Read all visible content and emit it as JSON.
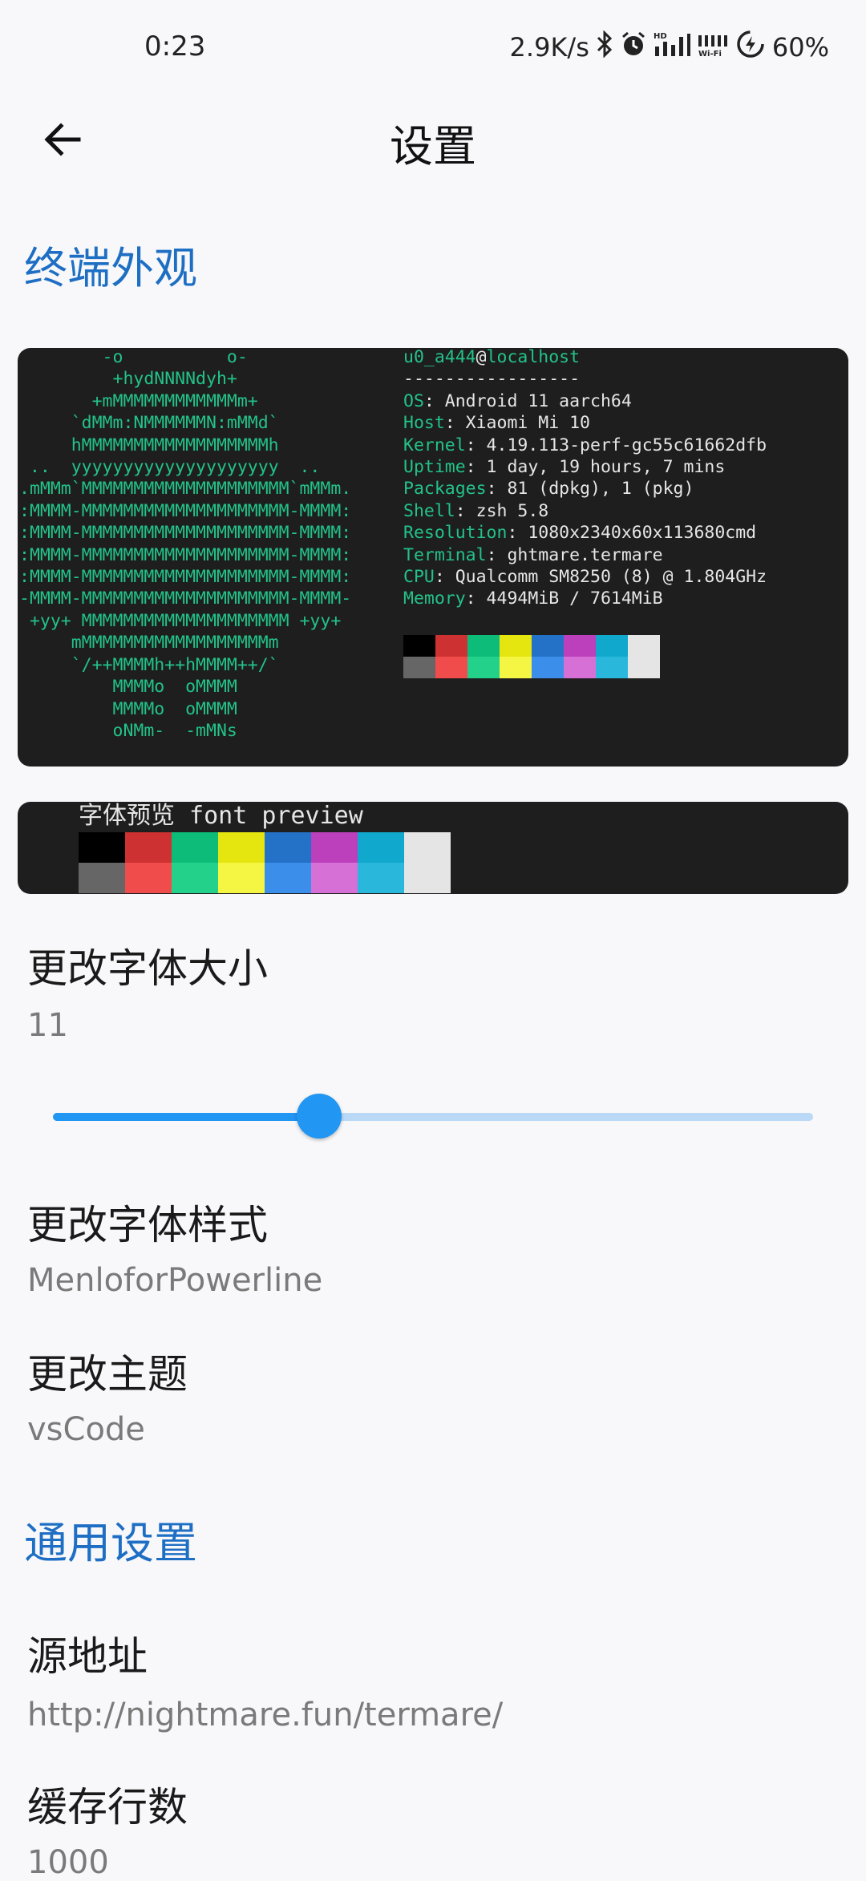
{
  "status_bar": {
    "time": "0:23",
    "net_speed": "2.9K/s",
    "battery": "60%"
  },
  "app_bar": {
    "title": "设置"
  },
  "sections": {
    "appearance": "终端外观",
    "general": "通用设置"
  },
  "neofetch": {
    "user": "u0_a444",
    "at": "@",
    "host": "localhost",
    "separator": "-----------------",
    "info": [
      {
        "key": "OS",
        "value": ": Android 11 aarch64"
      },
      {
        "key": "Host",
        "value": ": Xiaomi Mi 10"
      },
      {
        "key": "Kernel",
        "value": ": 4.19.113-perf-gc55c61662dfb"
      },
      {
        "key": "Uptime",
        "value": ": 1 day, 19 hours, 7 mins"
      },
      {
        "key": "Packages",
        "value": ": 81 (dpkg), 1 (pkg)"
      },
      {
        "key": "Shell",
        "value": ": zsh 5.8"
      },
      {
        "key": "Resolution",
        "value": ": 1080x2340x60x113680cmd"
      },
      {
        "key": "Terminal",
        "value": ": ghtmare.termare"
      },
      {
        "key": "CPU",
        "value": ": Qualcomm SM8250 (8) @ 1.804GHz"
      },
      {
        "key": "Memory",
        "value": ": 4494MiB / 7614MiB"
      }
    ],
    "logo": [
      "        -o          o-",
      "         +hydNNNNdyh+",
      "       +mMMMMMMMMMMMMm+",
      "     `dMMm:NMMMMMMN:mMMd`",
      "     hMMMMMMMMMMMMMMMMMMh",
      " ..  yyyyyyyyyyyyyyyyyyyy  ..",
      ".mMMm`MMMMMMMMMMMMMMMMMMMM`mMMm.",
      ":MMMM-MMMMMMMMMMMMMMMMMMMM-MMMM:",
      ":MMMM-MMMMMMMMMMMMMMMMMMMM-MMMM:",
      ":MMMM-MMMMMMMMMMMMMMMMMMMM-MMMM:",
      ":MMMM-MMMMMMMMMMMMMMMMMMMM-MMMM:",
      "-MMMM-MMMMMMMMMMMMMMMMMMMM-MMMM-",
      " +yy+ MMMMMMMMMMMMMMMMMMMM +yy+",
      "     mMMMMMMMMMMMMMMMMMMm",
      "     `/++MMMMh++hMMMM++/`",
      "         MMMMo  oMMMM",
      "         MMMMo  oMMMM",
      "         oNMm-  -mMNs"
    ],
    "palette_top": [
      "#000000",
      "#cd3131",
      "#0dbc79",
      "#e5e510",
      "#2472c8",
      "#bc3fbc",
      "#11a8cd",
      "#e5e5e5"
    ],
    "palette_bottom": [
      "#666666",
      "#f14c4c",
      "#23d18b",
      "#f5f543",
      "#3b8eea",
      "#d670d6",
      "#29b8db",
      "#e5e5e5"
    ]
  },
  "font_preview": {
    "label": "字体预览 font preview"
  },
  "settings": {
    "font_size": {
      "title": "更改字体大小",
      "value": "11",
      "slider_fraction": 0.35
    },
    "font_style": {
      "title": "更改字体样式",
      "value": "MenloforPowerline"
    },
    "theme": {
      "title": "更改主题",
      "value": "vsCode"
    },
    "source": {
      "title": "源地址",
      "value": "http://nightmare.fun/termare/"
    },
    "cache_lines": {
      "title": "缓存行数",
      "value": "1000"
    }
  },
  "colors": {
    "accent": "#2196f3",
    "section": "#1e6fc4",
    "terminal_bg": "#1e1e1e",
    "terminal_green": "#23c28a"
  }
}
